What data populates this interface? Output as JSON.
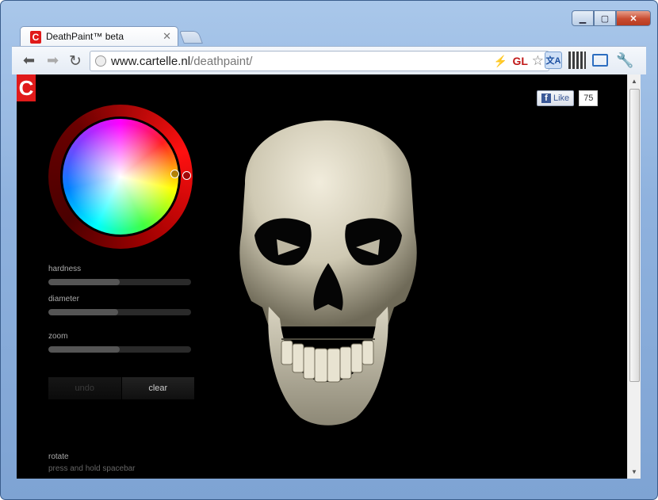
{
  "browser": {
    "tab_title": "DeathPaint™ beta",
    "tab_favicon_letter": "C",
    "url_host": "www.cartelle.nl",
    "url_path": "/deathpaint/",
    "omnibox_badge": "GL"
  },
  "page": {
    "logo_letter": "C",
    "facebook": {
      "like_label": "Like",
      "count": "75"
    },
    "controls": {
      "hardness": {
        "label": "hardness",
        "value": 0.5
      },
      "diameter": {
        "label": "diameter",
        "value": 0.49
      },
      "zoom": {
        "label": "zoom",
        "value": 0.5
      }
    },
    "buttons": {
      "undo": "undo",
      "clear": "clear"
    },
    "rotate": {
      "label": "rotate",
      "hint": "press and hold spacebar"
    }
  },
  "colors": {
    "background": "#000000",
    "accent_red": "#e01a1a",
    "skull": "#d8d3c0"
  }
}
